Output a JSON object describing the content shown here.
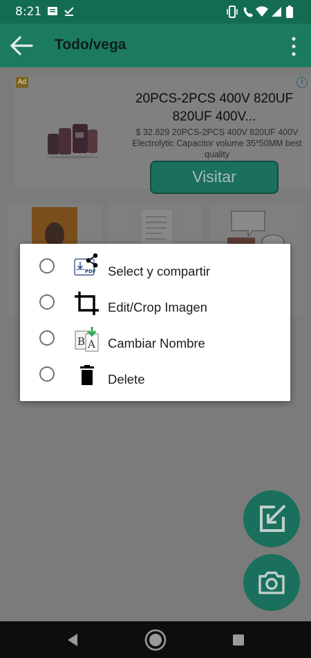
{
  "status_bar": {
    "time": "8:21",
    "icons": [
      "notification-icon",
      "download-done-icon",
      "vibrate-icon",
      "wifi-call-icon",
      "lte-icon",
      "wifi-icon",
      "signal-icon",
      "battery-icon"
    ]
  },
  "app_bar": {
    "title": "Todo/vega",
    "back_icon": "arrow-back-icon",
    "menu_icon": "more-vert-icon"
  },
  "ad": {
    "badge": "Ad",
    "info": "i",
    "headline": "20PCS-2PCS 400V 820UF 820UF 400V...",
    "description": "$ 32.829 20PCS-2PCS 400V 820UF 400V Electrolytic Capacitor volume 35*50MM best quality",
    "cta": "Visitar"
  },
  "dialog": {
    "options": [
      {
        "label": "Select y compartir",
        "icon": "share-pdf-icon"
      },
      {
        "label": "Edit/Crop Imagen",
        "icon": "crop-icon"
      },
      {
        "label": "Cambiar Nombre",
        "icon": "rename-icon"
      },
      {
        "label": "Delete",
        "icon": "delete-icon"
      }
    ]
  },
  "fabs": {
    "edit_icon": "edit-icon",
    "camera_icon": "camera-icon"
  },
  "nav_bar": {
    "back": "nav-back-icon",
    "home": "nav-home-icon",
    "recents": "nav-recents-icon"
  },
  "colors": {
    "status_bar": "#136b52",
    "app_bar": "#1c7a60",
    "accent": "#1a6f5d",
    "scrim": "#7b7b7b",
    "dialog_bg": "#ffffff"
  }
}
